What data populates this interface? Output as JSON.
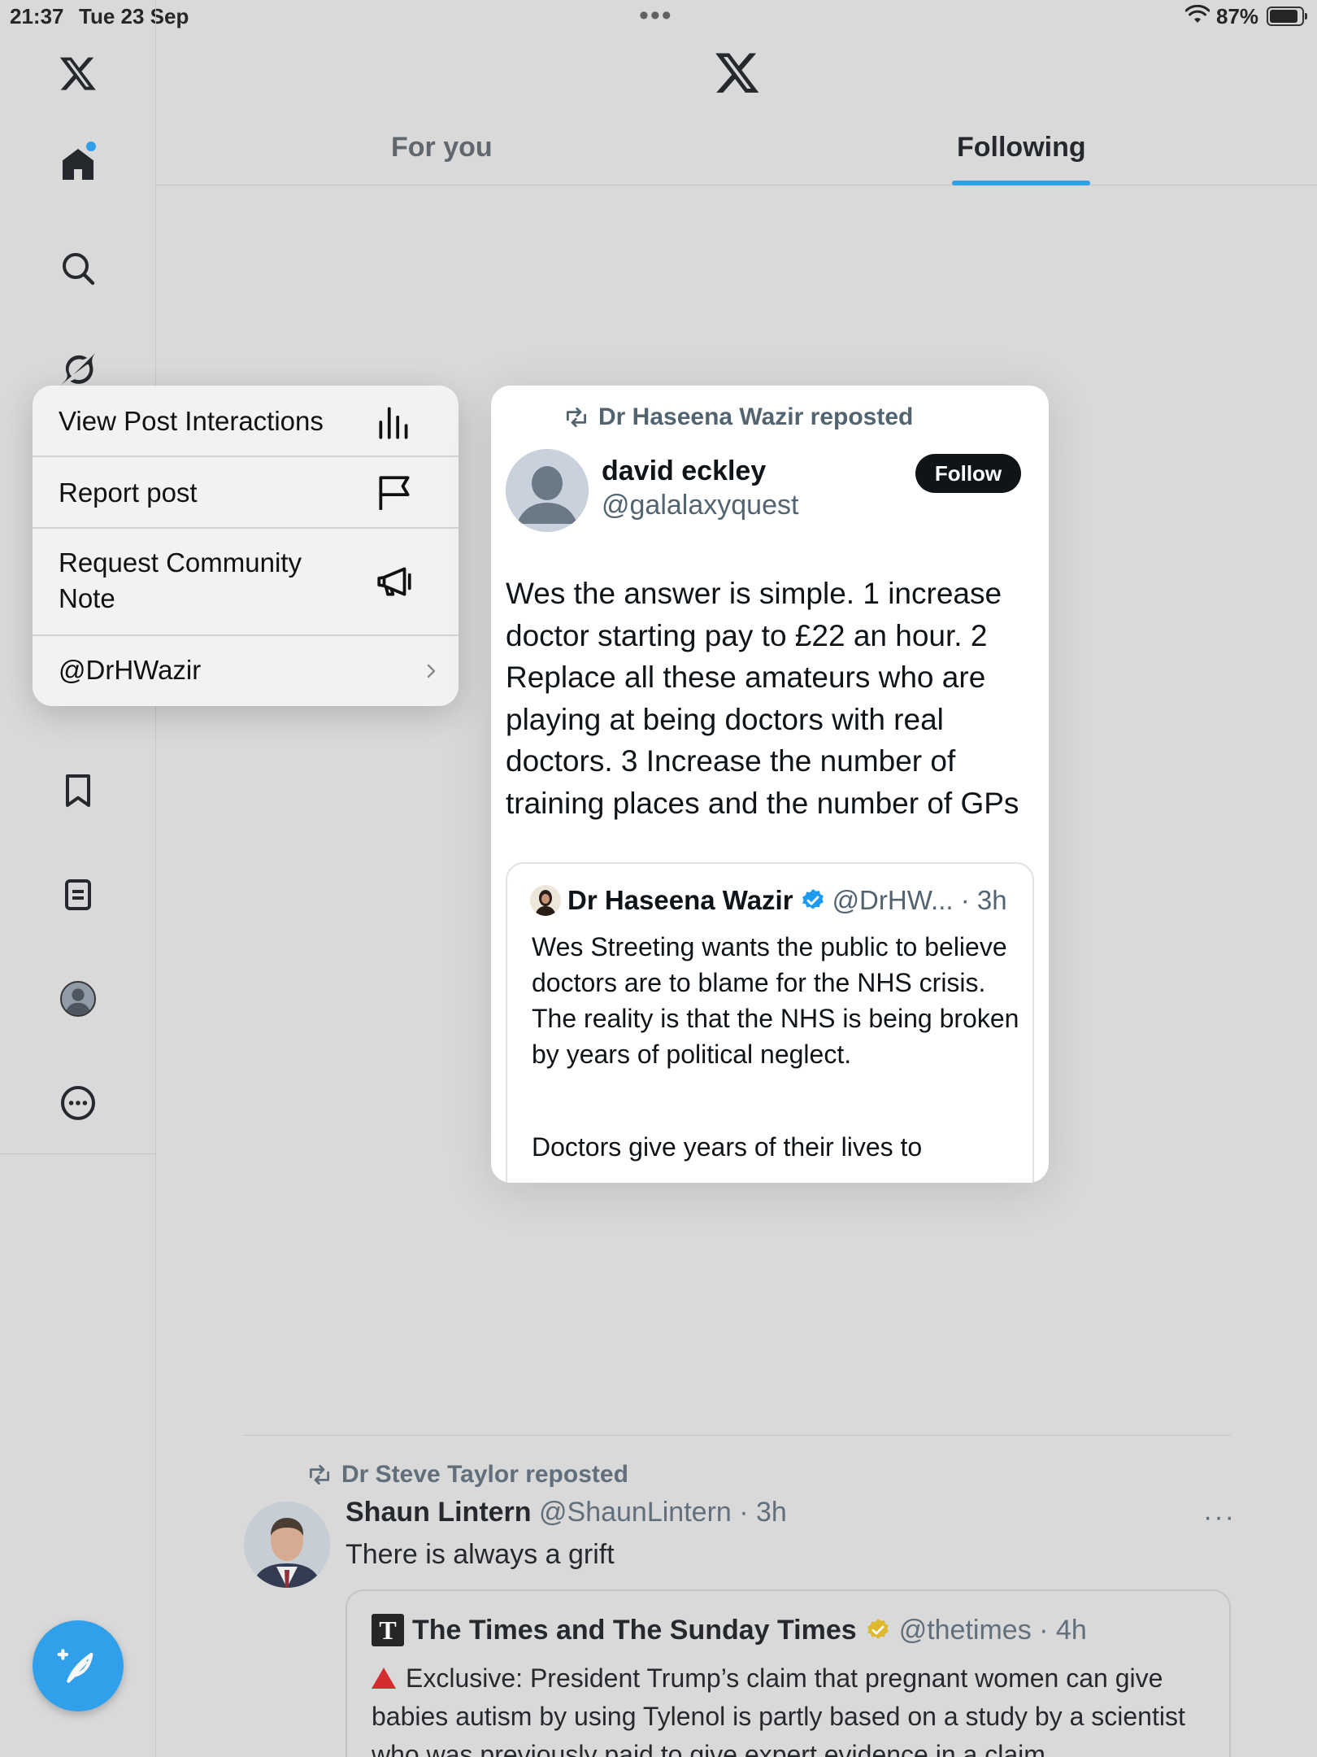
{
  "status_bar": {
    "time": "21:37",
    "date": "Tue 23 Sep",
    "battery_pct": "87%",
    "multitask_dots": "•••"
  },
  "sidebar": {
    "items": [
      {
        "name": "x-logo",
        "icon": "x-logo-icon"
      },
      {
        "name": "home",
        "icon": "home-icon"
      },
      {
        "name": "search",
        "icon": "search-icon"
      },
      {
        "name": "grok",
        "icon": "grok-icon"
      },
      {
        "name": "bookmarks",
        "icon": "bookmark-icon"
      },
      {
        "name": "lists",
        "icon": "list-icon"
      },
      {
        "name": "profile",
        "icon": "profile-icon"
      },
      {
        "name": "more",
        "icon": "more-icon"
      }
    ],
    "compose_icon": "compose-post-icon",
    "accent": "#1d9bf0"
  },
  "header": {
    "tabs": [
      {
        "label": "For you",
        "active": false
      },
      {
        "label": "Following",
        "active": true
      }
    ]
  },
  "context_menu": {
    "items": [
      {
        "label": "View Post Interactions",
        "icon": "bar-chart-icon"
      },
      {
        "label": "Report post",
        "icon": "flag-icon"
      },
      {
        "label": "Request Community Note",
        "icon": "megaphone-icon"
      },
      {
        "label": "@DrHWazir",
        "icon": "chevron-right-icon"
      }
    ]
  },
  "preview": {
    "repost_label": "Dr Haseena Wazir reposted",
    "author_name": "david eckley",
    "author_handle": "@galalaxyquest",
    "follow_label": "Follow",
    "text": "Wes the answer is simple. 1 increase doctor starting pay to £22 an hour. 2 Replace all these amateurs who are playing at being doctors with real doctors. 3 Increase the number of training places and the number of GPs",
    "quote": {
      "name": "Dr Haseena Wazir",
      "handle_time": "@DrHW... · 3h",
      "text": "Wes Streeting wants the public to believe doctors are to blame for the NHS crisis. The reality is that the NHS is being broken by years of political neglect.",
      "text2": "Doctors give years of their lives to"
    }
  },
  "feed": {
    "repost_label": "Dr Steve Taylor reposted",
    "name": "Shaun Lintern",
    "handle_time": "@ShaunLintern · 3h",
    "more_label": "···",
    "text": "There is always a grift",
    "quote": {
      "logo_letter": "T",
      "name": "The Times and The Sunday Times",
      "handle_time": "@thetimes · 4h",
      "text": "Exclusive: President Trump’s claim that pregnant women can give babies autism by using Tylenol is partly based on a study by a scientist who was previously paid to give expert evidence in a claim"
    }
  }
}
